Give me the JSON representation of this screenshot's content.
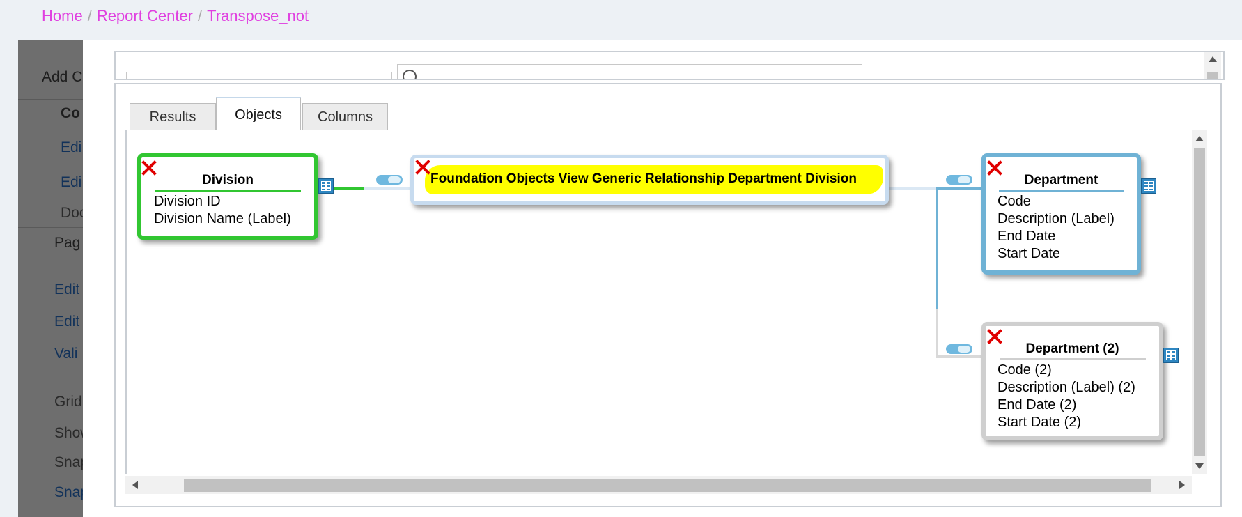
{
  "breadcrumb": {
    "items": [
      "Home",
      "Report Center",
      "Transpose_not"
    ],
    "separator": "/"
  },
  "background_page": {
    "items": [
      "Add C",
      "Co",
      "Edi",
      "Edi",
      "Doc",
      "Pag",
      "Edit",
      "Edit",
      "Vali",
      "Grid",
      "Show",
      "Snap",
      "Snap"
    ]
  },
  "tabs": [
    {
      "label": "Results",
      "active": false
    },
    {
      "label": "Objects",
      "active": true
    },
    {
      "label": "Columns",
      "active": false
    }
  ],
  "objects": {
    "division": {
      "title": "Division",
      "fields": [
        "Division ID",
        "Division Name (Label)"
      ],
      "border_color": "#31c631"
    },
    "relationship": {
      "title": "Foundation Objects View Generic Relationship Department Division",
      "highlight_color": "#ffff00"
    },
    "department": {
      "title": "Department",
      "fields": [
        "Code",
        "Description (Label)",
        "End Date",
        "Start Date"
      ],
      "border_color": "#6fb2d5"
    },
    "department2": {
      "title": "Department (2)",
      "fields": [
        "Code (2)",
        "Description (Label) (2)",
        "End Date (2)",
        "Start Date (2)"
      ],
      "border_color": "#cfcfcf"
    }
  },
  "icons": {
    "remove": "close-icon",
    "field_picker": "grid-icon",
    "join_toggle": "toggle-icon"
  },
  "colors": {
    "breadcrumb_link": "#e040e0",
    "join_line_green": "#31c631",
    "join_line_blue": "#6fb2d5"
  }
}
